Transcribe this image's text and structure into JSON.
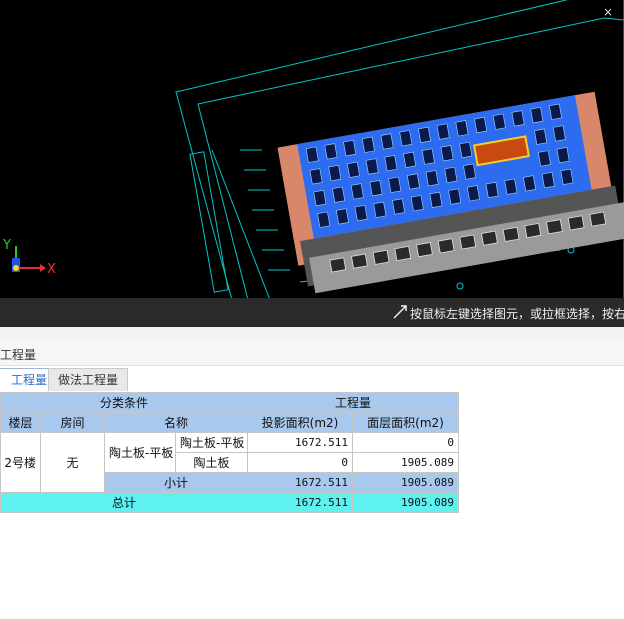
{
  "viewport": {
    "axis_y": "Y",
    "axis_x": "X",
    "status_text": "按鼠标左键选择图元，或拉框选择，按右",
    "close_glyph": "×"
  },
  "panel": {
    "title": "工程量",
    "tabs": [
      "工程量",
      "做法工程量"
    ]
  },
  "table": {
    "group_header_1": "分类条件",
    "group_header_2": "工程量",
    "col_floor": "楼层",
    "col_room": "房间",
    "col_name": "名称",
    "col_proj_area": "投影面积(m2)",
    "col_layer_area": "面层面积(m2)",
    "floor": "2号楼",
    "room": "无",
    "name_group": "陶土板-平板",
    "rows": [
      {
        "name": "陶土板-平板",
        "proj_area": "1672.511",
        "layer_area": "0"
      },
      {
        "name": "陶土板",
        "proj_area": "0",
        "layer_area": "1905.089"
      }
    ],
    "subtotal_label": "小计",
    "subtotal_proj": "1672.511",
    "subtotal_layer": "1905.089",
    "total_label": "总计",
    "total_proj": "1672.511",
    "total_layer": "1905.089"
  },
  "colors": {
    "cad_background": "#000000",
    "cad_lines": "#00d2d2",
    "roof_blue": "#2d6cf0",
    "terracotta": "#d9876a",
    "header_blue": "#a8c8ee",
    "total_cyan": "#5ff0f0"
  }
}
